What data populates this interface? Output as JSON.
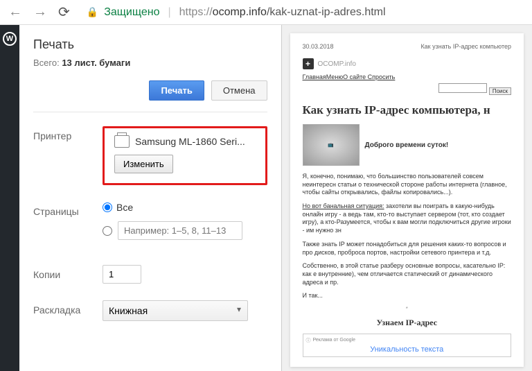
{
  "browser": {
    "secure_label": "Защищено",
    "url_https": "https://",
    "url_domain": "ocomp.info",
    "url_path": "/kak-uznat-ip-adres.html"
  },
  "print": {
    "title": "Печать",
    "sheet_prefix": "Всего: ",
    "sheet_count": "13 лист. бумаги",
    "print_btn": "Печать",
    "cancel_btn": "Отмена",
    "printer_label": "Принтер",
    "printer_name": "Samsung ML-1860 Seri...",
    "change_btn": "Изменить",
    "pages_label": "Страницы",
    "pages_all": "Все",
    "pages_placeholder": "Например: 1–5, 8, 11–13",
    "copies_label": "Копии",
    "copies_value": "1",
    "layout_label": "Раскладка",
    "layout_value": "Книжная"
  },
  "preview": {
    "date": "30.03.2018",
    "header_right": "Как узнать IP-адрес компьютер",
    "nav": "ГлавнаяМенюО сайте    Спросить",
    "search_btn": "Поиск",
    "title": "Как узнать IP-адрес компьютера, н",
    "greeting": "Доброго времени суток!",
    "p1": "Я, конечно, понимаю, что большинство пользователей совсем неинтересн статьи о технической стороне работы интернета (главное, чтобы сайты открывались, файлы копировались...).",
    "p2_u": "Но вот банальная ситуация:",
    "p2": " захотели вы поиграть в какую-нибудь онлайн игру - а ведь там, кто-то выступает сервером (тот, кто создает игру), а кто-Разумеется, чтобы к вам могли подключиться другие игроки - им нужно зн",
    "p3": "Также знать IP может понадобиться для решения каких-то вопросов и про дисков, проброса портов, настройки сетевого принтера и т.д.",
    "p4": "Собственно, в этой статье разберу основные вопросы, касательно IP: как е внутренние), чем отличается статический от динамического адреса и пр.",
    "p5": "И так...",
    "sub": "Узнаем IP-адрес",
    "ad_label": "Реклама от Google",
    "ad_title": "Уникальность текста"
  }
}
